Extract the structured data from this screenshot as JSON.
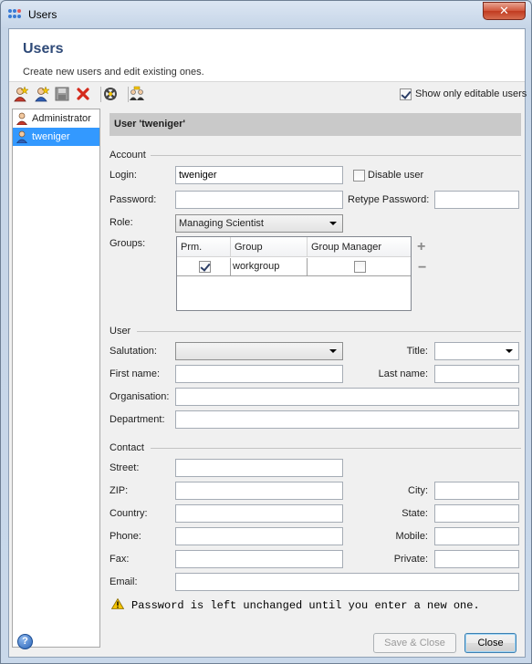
{
  "window": {
    "title": "Users",
    "close_glyph": "✕"
  },
  "header": {
    "title": "Users",
    "subtitle": "Create new users and edit existing ones."
  },
  "toolbar": {
    "buttons": [
      "add-user-icon",
      "copy-user-icon",
      "save-icon",
      "delete-icon",
      "delete-wizard-icon",
      "group-manage-icon"
    ],
    "show_editable_label": "Show only editable users",
    "show_editable_checked": true
  },
  "users": [
    {
      "name": "Administrator",
      "selected": false
    },
    {
      "name": "tweniger",
      "selected": true
    }
  ],
  "detail": {
    "header": "User 'tweniger'",
    "account": {
      "section": "Account",
      "login_label": "Login:",
      "login_value": "tweniger",
      "disable_label": "Disable user",
      "password_label": "Password:",
      "retype_label": "Retype Password:",
      "role_label": "Role:",
      "role_value": "Managing Scientist",
      "groups_label": "Groups:",
      "groups_columns": [
        "Prm.",
        "Group",
        "Group Manager"
      ],
      "groups_rows": [
        {
          "primary": true,
          "group": "workgroup",
          "manager": false
        }
      ],
      "add_glyph": "+",
      "remove_glyph": "−"
    },
    "user": {
      "section": "User",
      "salutation_label": "Salutation:",
      "title_label": "Title:",
      "first_name_label": "First name:",
      "last_name_label": "Last name:",
      "organisation_label": "Organisation:",
      "department_label": "Department:"
    },
    "contact": {
      "section": "Contact",
      "street_label": "Street:",
      "zip_label": "ZIP:",
      "city_label": "City:",
      "country_label": "Country:",
      "state_label": "State:",
      "phone_label": "Phone:",
      "mobile_label": "Mobile:",
      "fax_label": "Fax:",
      "private_label": "Private:",
      "email_label": "Email:"
    },
    "warning": "Password is left unchanged until you enter a new one."
  },
  "footer": {
    "help_glyph": "?",
    "save_close": "Save & Close",
    "close": "Close"
  }
}
